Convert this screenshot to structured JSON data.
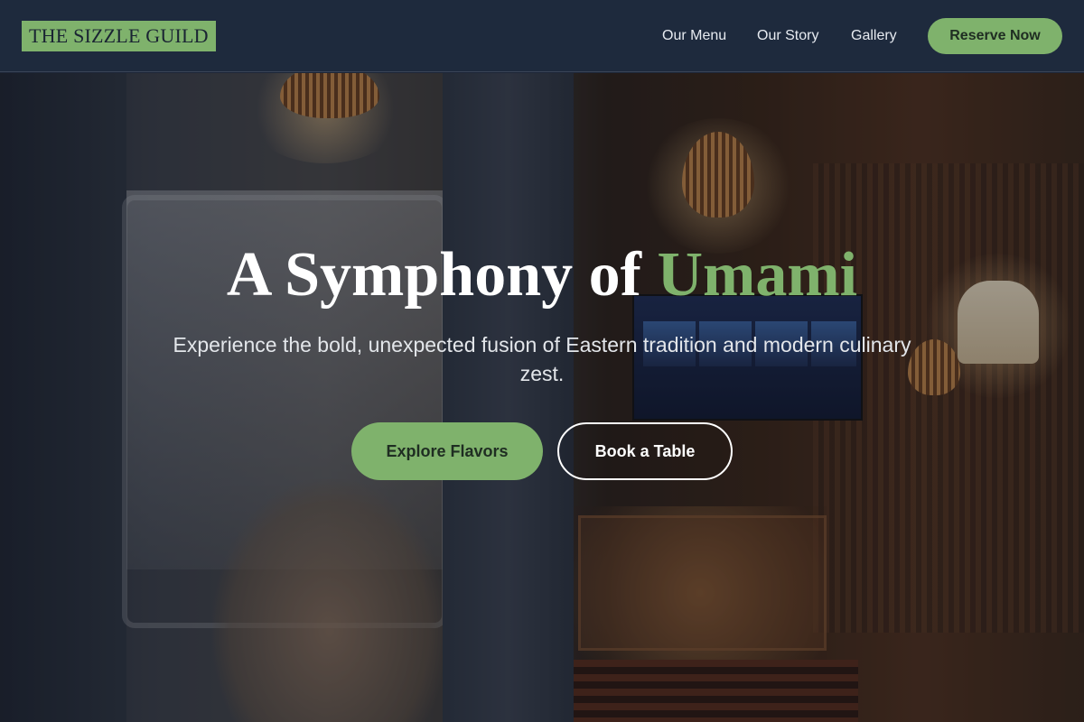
{
  "brand": {
    "name": "THE SIZZLE GUILD"
  },
  "nav": {
    "links": [
      {
        "label": "Our Menu"
      },
      {
        "label": "Our Story"
      },
      {
        "label": "Gallery"
      }
    ],
    "cta_label": "Reserve Now"
  },
  "hero": {
    "title_main": "A Symphony of ",
    "title_accent": "Umami",
    "subtitle": "Experience the bold, unexpected fusion of Eastern tradition and modern culinary zest.",
    "primary_button": "Explore Flavors",
    "secondary_button": "Book a Table",
    "background_image": "restaurant interior photo with hanging lamps and menu board"
  },
  "colors": {
    "accent": "#7fb26c",
    "nav_bg": "#1e2a3d",
    "text_light": "#ffffff"
  }
}
